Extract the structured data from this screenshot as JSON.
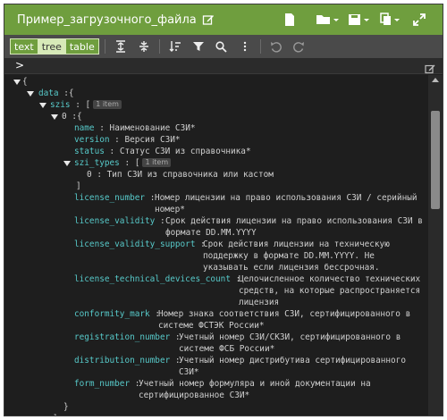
{
  "header": {
    "title": "Пример_загрузочного_файла",
    "icons": [
      "edit-icon",
      "file-icon",
      "folder-open-icon",
      "save-icon",
      "copy-icon",
      "expand-icon"
    ]
  },
  "toolbar": {
    "modes": [
      "text",
      "tree",
      "table"
    ],
    "active_mode": "tree"
  },
  "navbar": {
    "path_chevron": ">"
  },
  "tree": {
    "root_open": "{",
    "data_key": "data",
    "szis_key": "szis",
    "szis_badge": "1 item",
    "item0_key": "0",
    "name_key": "name",
    "name_val": "Наименование СЗИ*",
    "version_key": "version",
    "version_val": "Версия СЗИ*",
    "status_key": "status",
    "status_val": "Статус СЗИ из справочника*",
    "types_key": "szi_types",
    "types_badge": "1 item",
    "types_item_key": "0",
    "types_item_val": "Тип СЗИ из справочника или кастом",
    "license_number_key": "license_number",
    "license_number_val": "Номер лицензии на право использования СЗИ / серийный номер*",
    "license_validity_key": "license_validity",
    "license_validity_val": "Срок действия лицензии на право использования СЗИ в формате DD.MM.YYYY",
    "license_validity_support_key": "license_validity_support",
    "license_validity_support_val": "Срок действия лицензии на техническую поддержку в формате DD.MM.YYYY. Не указывать если лицензия бессрочная.",
    "license_tech_key": "license_technical_devices_count",
    "license_tech_val": "Целочисленное количество технических средств, на которые распространяется лицензия",
    "conformity_key": "conformity_mark",
    "conformity_val": "Номер знака соответствия СЗИ, сертифицированного в системе ФСТЭК России*",
    "registration_key": "registration_number",
    "registration_val": "Учетный номер СЗИ/СКЗИ, сертифицированного в системе ФСБ России*",
    "distribution_key": "distribution_number",
    "distribution_val": "Учетный номер дистрибутива сертифицированного СЗИ*",
    "form_key": "form_number",
    "form_val": "Учетный номер формуляра и иной документации на сертифицированное СЗИ*",
    "close_obj": "}",
    "close_arr": "]",
    "colon": ":",
    "bracket_open": "[",
    "brace_open": "{"
  }
}
